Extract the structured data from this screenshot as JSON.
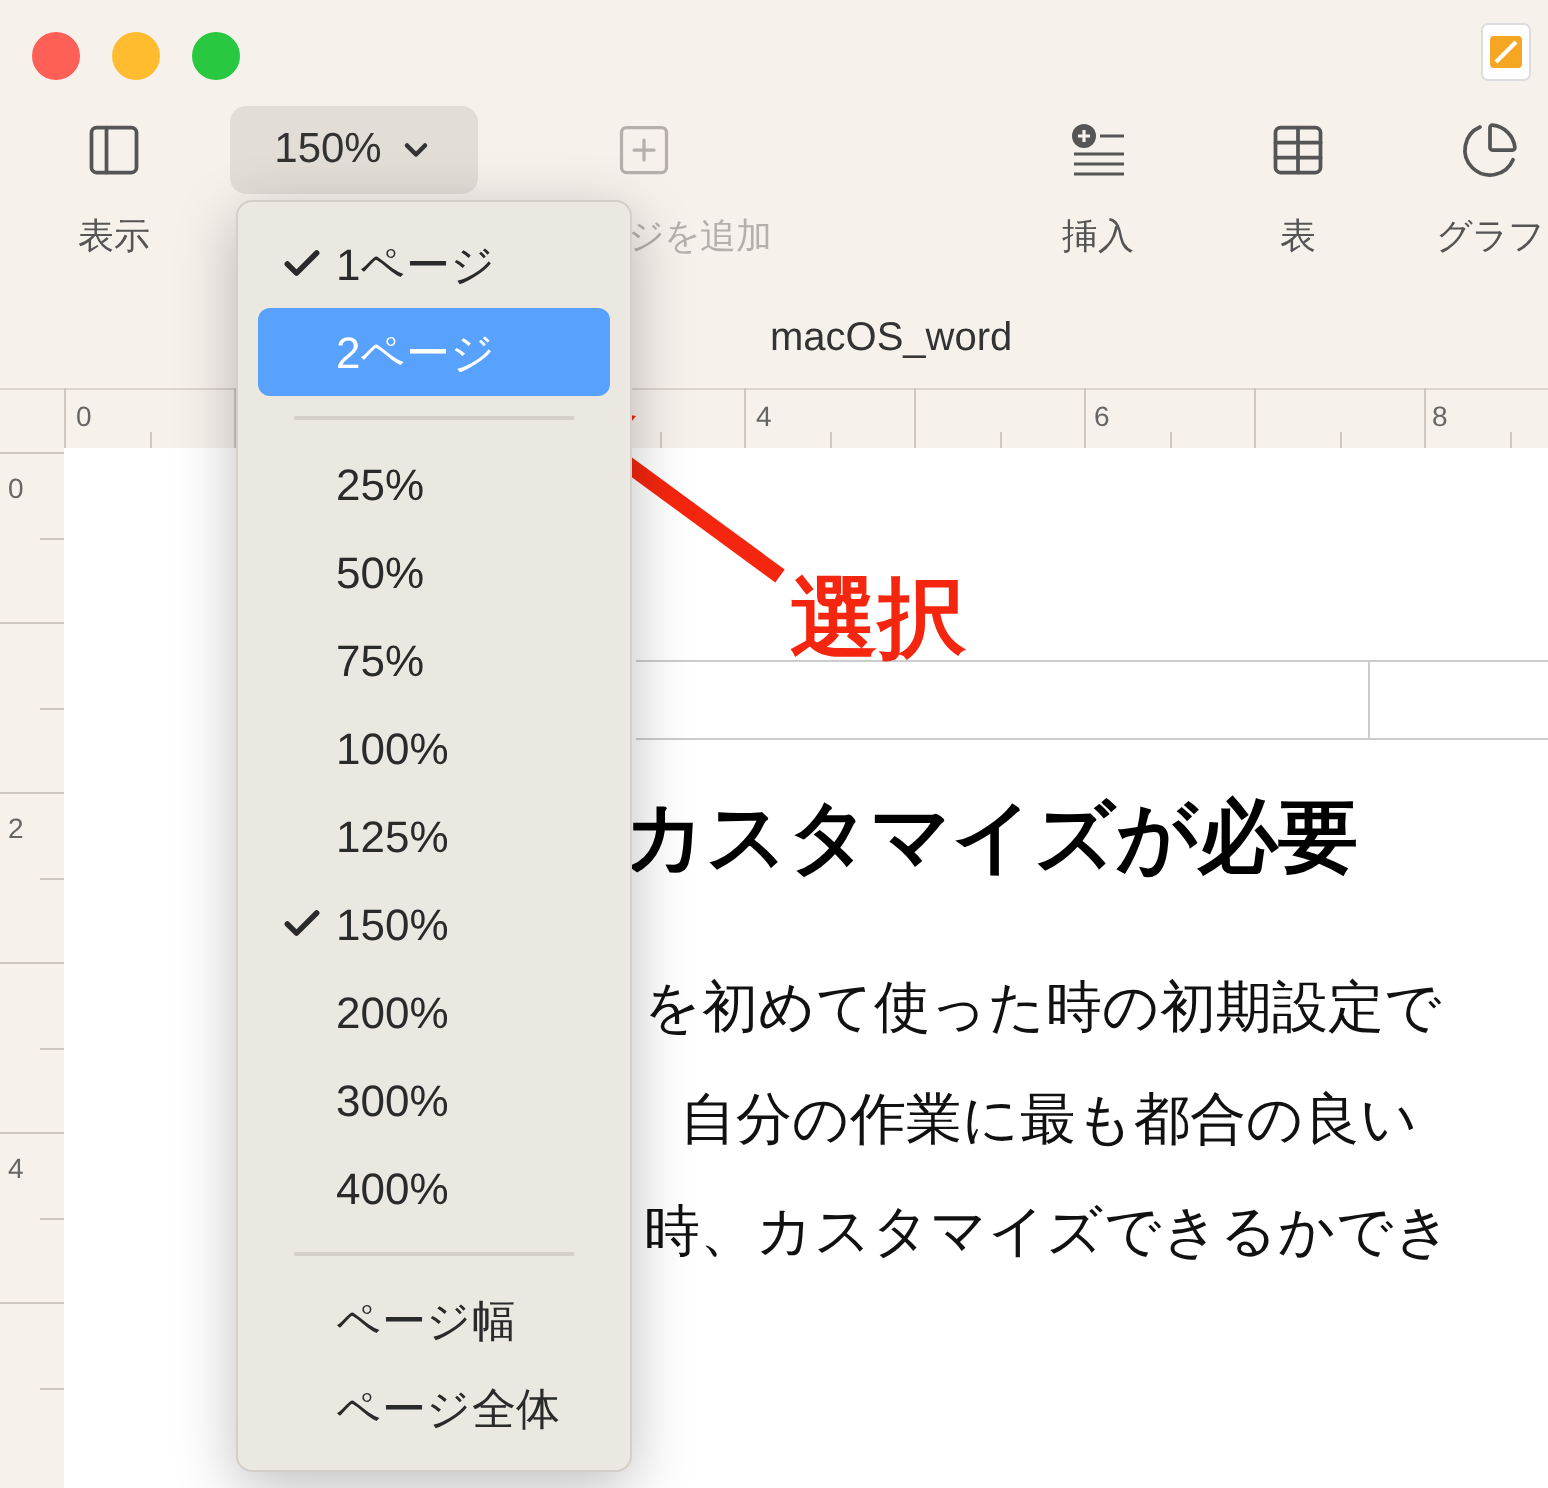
{
  "toolbar": [
    {
      "kind": "view",
      "label": "表示",
      "disabled": false
    },
    {
      "kind": "zoom",
      "label": "150%",
      "disabled": false
    },
    {
      "kind": "add_page",
      "label": "ジを追加",
      "disabled": true
    },
    {
      "kind": "insert",
      "label": "挿入",
      "disabled": false
    },
    {
      "kind": "table",
      "label": "表",
      "disabled": false
    },
    {
      "kind": "chart",
      "label": "グラフ",
      "disabled": false
    }
  ],
  "document_title": "macOS_word",
  "ruler": {
    "horizontal": [
      "0",
      "4",
      "6",
      "8"
    ],
    "vertical": [
      "0",
      "2",
      "4"
    ]
  },
  "document": {
    "heading": "カスタマイズが必要",
    "paragraphs": [
      "を初めて使った時の初期設定で",
      "自分の作業に最も都合の良い",
      "時、カスタマイズできるかでき"
    ]
  },
  "zoom_menu": {
    "sections": [
      [
        {
          "label": "1ページ",
          "checked": true,
          "selected": false
        },
        {
          "label": "2ページ",
          "checked": false,
          "selected": true
        }
      ],
      [
        {
          "label": "25%",
          "checked": false,
          "selected": false
        },
        {
          "label": "50%",
          "checked": false,
          "selected": false
        },
        {
          "label": "75%",
          "checked": false,
          "selected": false
        },
        {
          "label": "100%",
          "checked": false,
          "selected": false
        },
        {
          "label": "125%",
          "checked": false,
          "selected": false
        },
        {
          "label": "150%",
          "checked": true,
          "selected": false
        },
        {
          "label": "200%",
          "checked": false,
          "selected": false
        },
        {
          "label": "300%",
          "checked": false,
          "selected": false
        },
        {
          "label": "400%",
          "checked": false,
          "selected": false
        }
      ],
      [
        {
          "label": "ページ幅",
          "checked": false,
          "selected": false
        },
        {
          "label": "ページ全体",
          "checked": false,
          "selected": false
        }
      ]
    ]
  },
  "annotation": {
    "label": "選択"
  }
}
